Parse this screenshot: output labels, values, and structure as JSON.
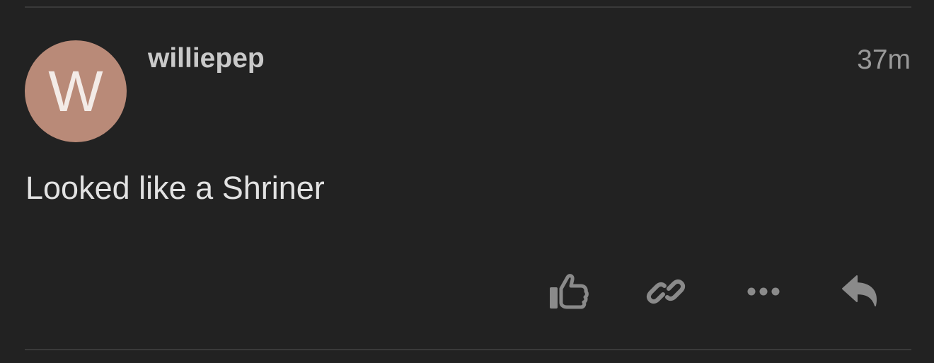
{
  "post": {
    "avatar_letter": "W",
    "avatar_color": "#b98a78",
    "username": "williepep",
    "timestamp": "37m",
    "body": "Looked like a Shriner"
  },
  "actions": [
    {
      "name": "like",
      "icon": "thumbs-up-icon"
    },
    {
      "name": "copy-link",
      "icon": "link-icon"
    },
    {
      "name": "more",
      "icon": "ellipsis-icon"
    },
    {
      "name": "reply",
      "icon": "reply-icon"
    }
  ]
}
